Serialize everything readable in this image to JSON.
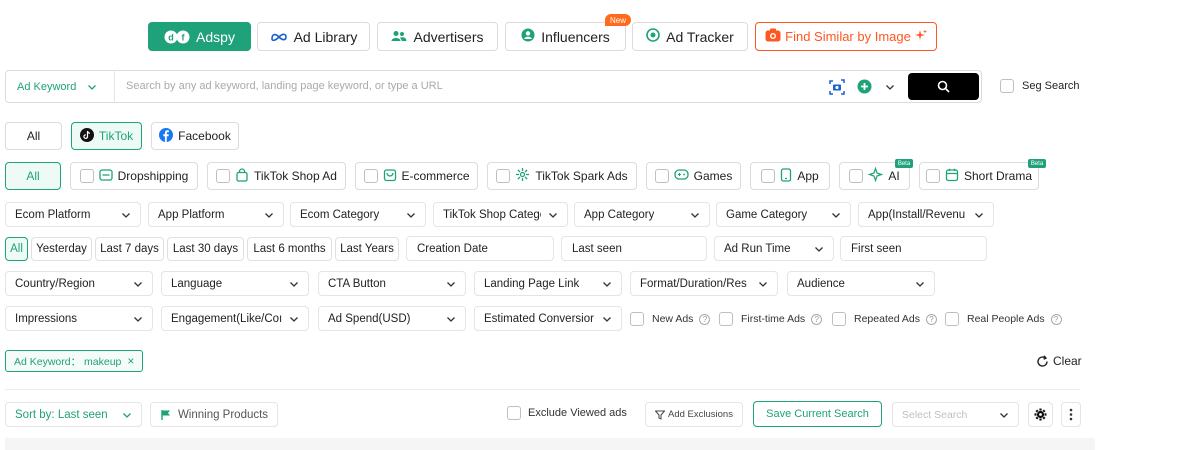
{
  "topnav": {
    "adspy": "Adspy",
    "ad_library": "Ad Library",
    "advertisers": "Advertisers",
    "influencers": "Influencers",
    "new_badge": "New",
    "ad_tracker": "Ad Tracker",
    "find_similar": "Find Similar by Image"
  },
  "search": {
    "type_select": "Ad Keyword",
    "placeholder": "Search by any ad keyword, landing page keyword, or type a URL",
    "seg_search": "Seg Search"
  },
  "platforms": {
    "all": "All",
    "tiktok": "TikTok",
    "facebook": "Facebook"
  },
  "categories": {
    "all": "All",
    "dropshipping": "Dropshipping",
    "tiktok_shop_ad": "TikTok Shop Ad",
    "ecommerce": "E-commerce",
    "spark_ads": "TikTok Spark Ads",
    "games": "Games",
    "app": "App",
    "ai": "AI",
    "short_drama": "Short Drama",
    "beta": "Beta"
  },
  "filters_row1": {
    "ecom_platform": "Ecom Platform",
    "app_platform": "App Platform",
    "ecom_category": "Ecom Category",
    "tiktok_shop_category": "TikTok Shop Categé",
    "app_category": "App Category",
    "game_category": "Game Category",
    "app_install": "App(Install/Revenu"
  },
  "time": {
    "all": "All",
    "yesterday": "Yesterday",
    "last7": "Last 7 days",
    "last30": "Last 30 days",
    "last6m": "Last 6 months",
    "lastyears": "Last Years",
    "creation_date": "Creation Date",
    "last_seen": "Last seen",
    "ad_run_time": "Ad Run Time",
    "first_seen": "First seen"
  },
  "filters_row3": {
    "country": "Country/Region",
    "language": "Language",
    "cta": "CTA Button",
    "landing": "Landing Page Link",
    "format": "Format/Duration/Res",
    "audience": "Audience"
  },
  "filters_row4": {
    "impressions": "Impressions",
    "engagement": "Engagement(Like/Coı",
    "ad_spend": "Ad Spend(USD)",
    "conversion": "Estimated Conversior",
    "new_ads": "New Ads",
    "first_time_ads": "First-time Ads",
    "repeated_ads": "Repeated Ads",
    "real_people_ads": "Real People Ads"
  },
  "active_tag": {
    "label": "Ad Keyword： makeup",
    "close": "×"
  },
  "clear": "Clear",
  "toolbar": {
    "sort": "Sort by: Last seen",
    "winning": "Winning Products",
    "exclude_viewed": "Exclude Viewed ads",
    "add_exclusions": "Add Exclusions",
    "save_search": "Save Current Search",
    "select_search": "Select Search"
  },
  "colors": {
    "accent": "#1fa27a",
    "orange": "#ff5722",
    "black": "#000000"
  }
}
